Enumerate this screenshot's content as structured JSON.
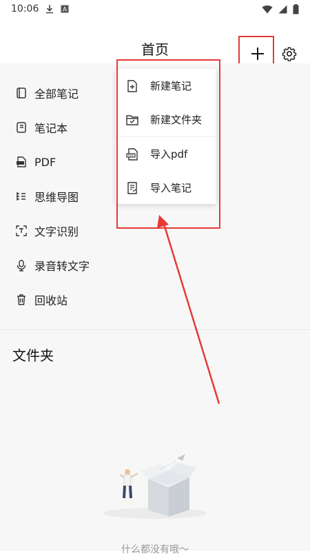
{
  "status_bar": {
    "time": "10:06",
    "icons": [
      "download-icon",
      "app-a-icon",
      "wifi-icon",
      "signal-icon",
      "battery-icon"
    ]
  },
  "header": {
    "title": "首页",
    "add_icon": "plus-icon",
    "settings_icon": "gear-icon"
  },
  "nav": {
    "items": [
      {
        "label": "全部笔记",
        "icon": "all-notes-icon"
      },
      {
        "label": "笔记本",
        "icon": "notebook-icon"
      },
      {
        "label": "PDF",
        "icon": "pdf-icon"
      },
      {
        "label": "思维导图",
        "icon": "mindmap-icon"
      },
      {
        "label": "文字识别",
        "icon": "scan-text-icon"
      },
      {
        "label": "录音转文字",
        "icon": "microphone-icon"
      },
      {
        "label": "回收站",
        "icon": "trash-icon"
      }
    ]
  },
  "folders": {
    "title": "文件夹",
    "empty_text": "什么都没有哦～"
  },
  "dropdown": {
    "items": [
      {
        "label": "新建笔记",
        "icon": "new-note-icon"
      },
      {
        "label": "新建文件夹",
        "icon": "new-folder-icon"
      },
      {
        "label": "导入pdf",
        "icon": "import-pdf-icon"
      },
      {
        "label": "导入笔记",
        "icon": "import-note-icon"
      }
    ]
  },
  "colors": {
    "accent_red": "#e53935",
    "background_grey": "#f7f7f7",
    "text_primary": "#222222",
    "text_muted": "#9a9a9a"
  }
}
